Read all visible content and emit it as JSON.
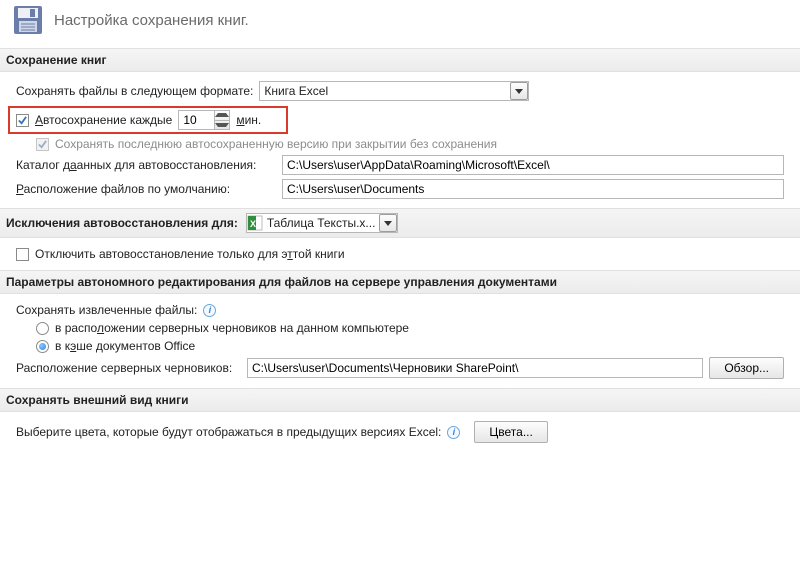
{
  "header": {
    "title": "Настройка сохранения книг."
  },
  "sections": {
    "save_books": "Сохранение книг",
    "exclusions": "Исключения автовосстановления для:",
    "offline": "Параметры автономного редактирования для файлов на сервере управления документами",
    "appearance": "Сохранять внешний вид книги"
  },
  "fields": {
    "save_format_label": "Сохранять файлы в следующем формате:",
    "save_format_value": "Книга Excel",
    "autosave_label_pre": "А",
    "autosave_label_post": "втосохранение каждые",
    "autosave_value": "10",
    "autosave_unit_pre": "м",
    "autosave_unit_post": "ин.",
    "keep_last_label": "Сохранять последнюю автосохраненную версию при закрытии без сохранения",
    "autorecover_dir_label": "Каталог д",
    "autorecover_dir_label2": "анных для автовосстановления:",
    "autorecover_dir_value": "C:\\Users\\user\\AppData\\Roaming\\Microsoft\\Excel\\",
    "default_loc_label_pre": "Р",
    "default_loc_label_post": "асположение файлов по умолчанию:",
    "default_loc_value": "C:\\Users\\user\\Documents",
    "exclusions_file": "Таблица Тексты.x...",
    "disable_autorecover_label": "Отключить автовосстановление только для э",
    "disable_autorecover_label2": "той книги",
    "extracted_files_label": "Сохранять извлеченные файлы:",
    "opt_server_drafts": "в расположении серверных черновиков на данном компьютере",
    "opt_office_cache_pre": "в к",
    "opt_office_cache_post": "ше документов Office",
    "drafts_loc_label": "Расположение серверных черновиков:",
    "drafts_loc_value": "C:\\Users\\user\\Documents\\Черновики SharePoint\\",
    "browse_btn_pre": "О",
    "browse_btn_post": "бзор...",
    "colors_label": "Выберите цвета, которые будут отображаться в предыдущих версиях Excel:",
    "colors_btn_pre": "Ц",
    "colors_btn_post": "вета..."
  }
}
